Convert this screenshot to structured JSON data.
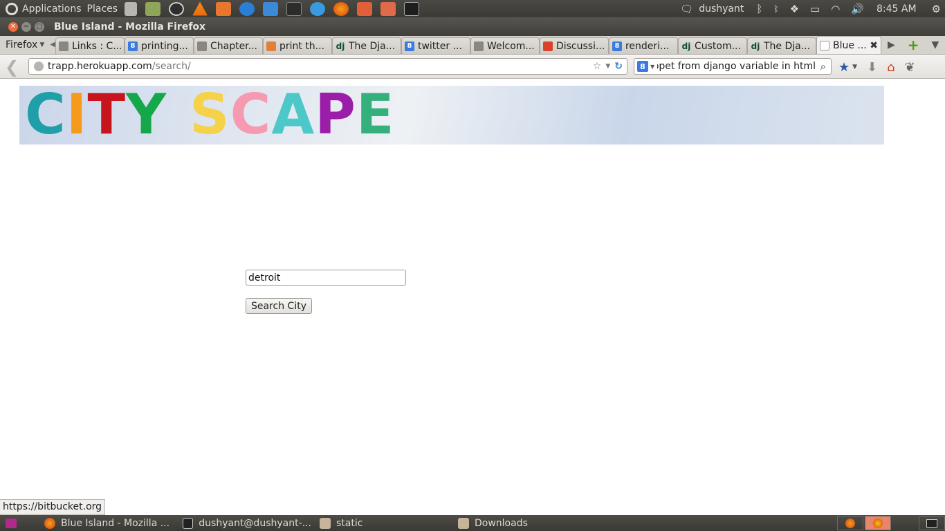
{
  "system_panel": {
    "applications_label": "Applications",
    "places_label": "Places",
    "user_name": "dushyant",
    "clock": "8:45 AM"
  },
  "window": {
    "title": "Blue Island - Mozilla Firefox"
  },
  "browser": {
    "menu_label": "Firefox",
    "tabs": [
      {
        "label": "Links : C...",
        "icon": "page-icon"
      },
      {
        "label": "printing...",
        "icon": "google-icon"
      },
      {
        "label": "Chapter...",
        "icon": "page-icon"
      },
      {
        "label": "print th...",
        "icon": "stackoverflow-icon"
      },
      {
        "label": "The Dja...",
        "icon": "django-icon"
      },
      {
        "label": "twitter ...",
        "icon": "google-icon"
      },
      {
        "label": "Welcom...",
        "icon": "page-icon"
      },
      {
        "label": "Discussi...",
        "icon": "chrome-icon"
      },
      {
        "label": "renderi...",
        "icon": "google-icon"
      },
      {
        "label": "Custom...",
        "icon": "django-icon"
      },
      {
        "label": "The Dja...",
        "icon": "django-icon"
      },
      {
        "label": "Blue ...",
        "icon": "blank-page-icon"
      }
    ],
    "url_host": "trapp.herokuapp.com",
    "url_path": "/search/",
    "search_value": "ippet from  django variable in html",
    "status_url": "https://bitbucket.org"
  },
  "page": {
    "logo_letters": [
      "C",
      "I",
      "T",
      "Y",
      "S",
      "C",
      "A",
      "P",
      "E"
    ],
    "logo_colors": [
      "#1fa0a8",
      "#f59b1c",
      "#c8141c",
      "#14a84a",
      "#f5d24a",
      "#f59ab0",
      "#4cc8c8",
      "#9a1ea8",
      "#34b07c"
    ],
    "city_input_value": "detroit",
    "search_button_label": "Search City"
  },
  "taskbar": {
    "items": [
      {
        "label": "Blue Island - Mozilla ...",
        "icon": "firefox-icon"
      },
      {
        "label": "dushyant@dushyant-...",
        "icon": "terminal-icon"
      },
      {
        "label": "static",
        "icon": "folder-icon"
      },
      {
        "label": "Downloads",
        "icon": "folder-icon"
      }
    ]
  },
  "colors": {
    "panel_bg": "#3b3a36",
    "banner_sky": "#cbd6ea",
    "close_button": "#f06a3b"
  }
}
